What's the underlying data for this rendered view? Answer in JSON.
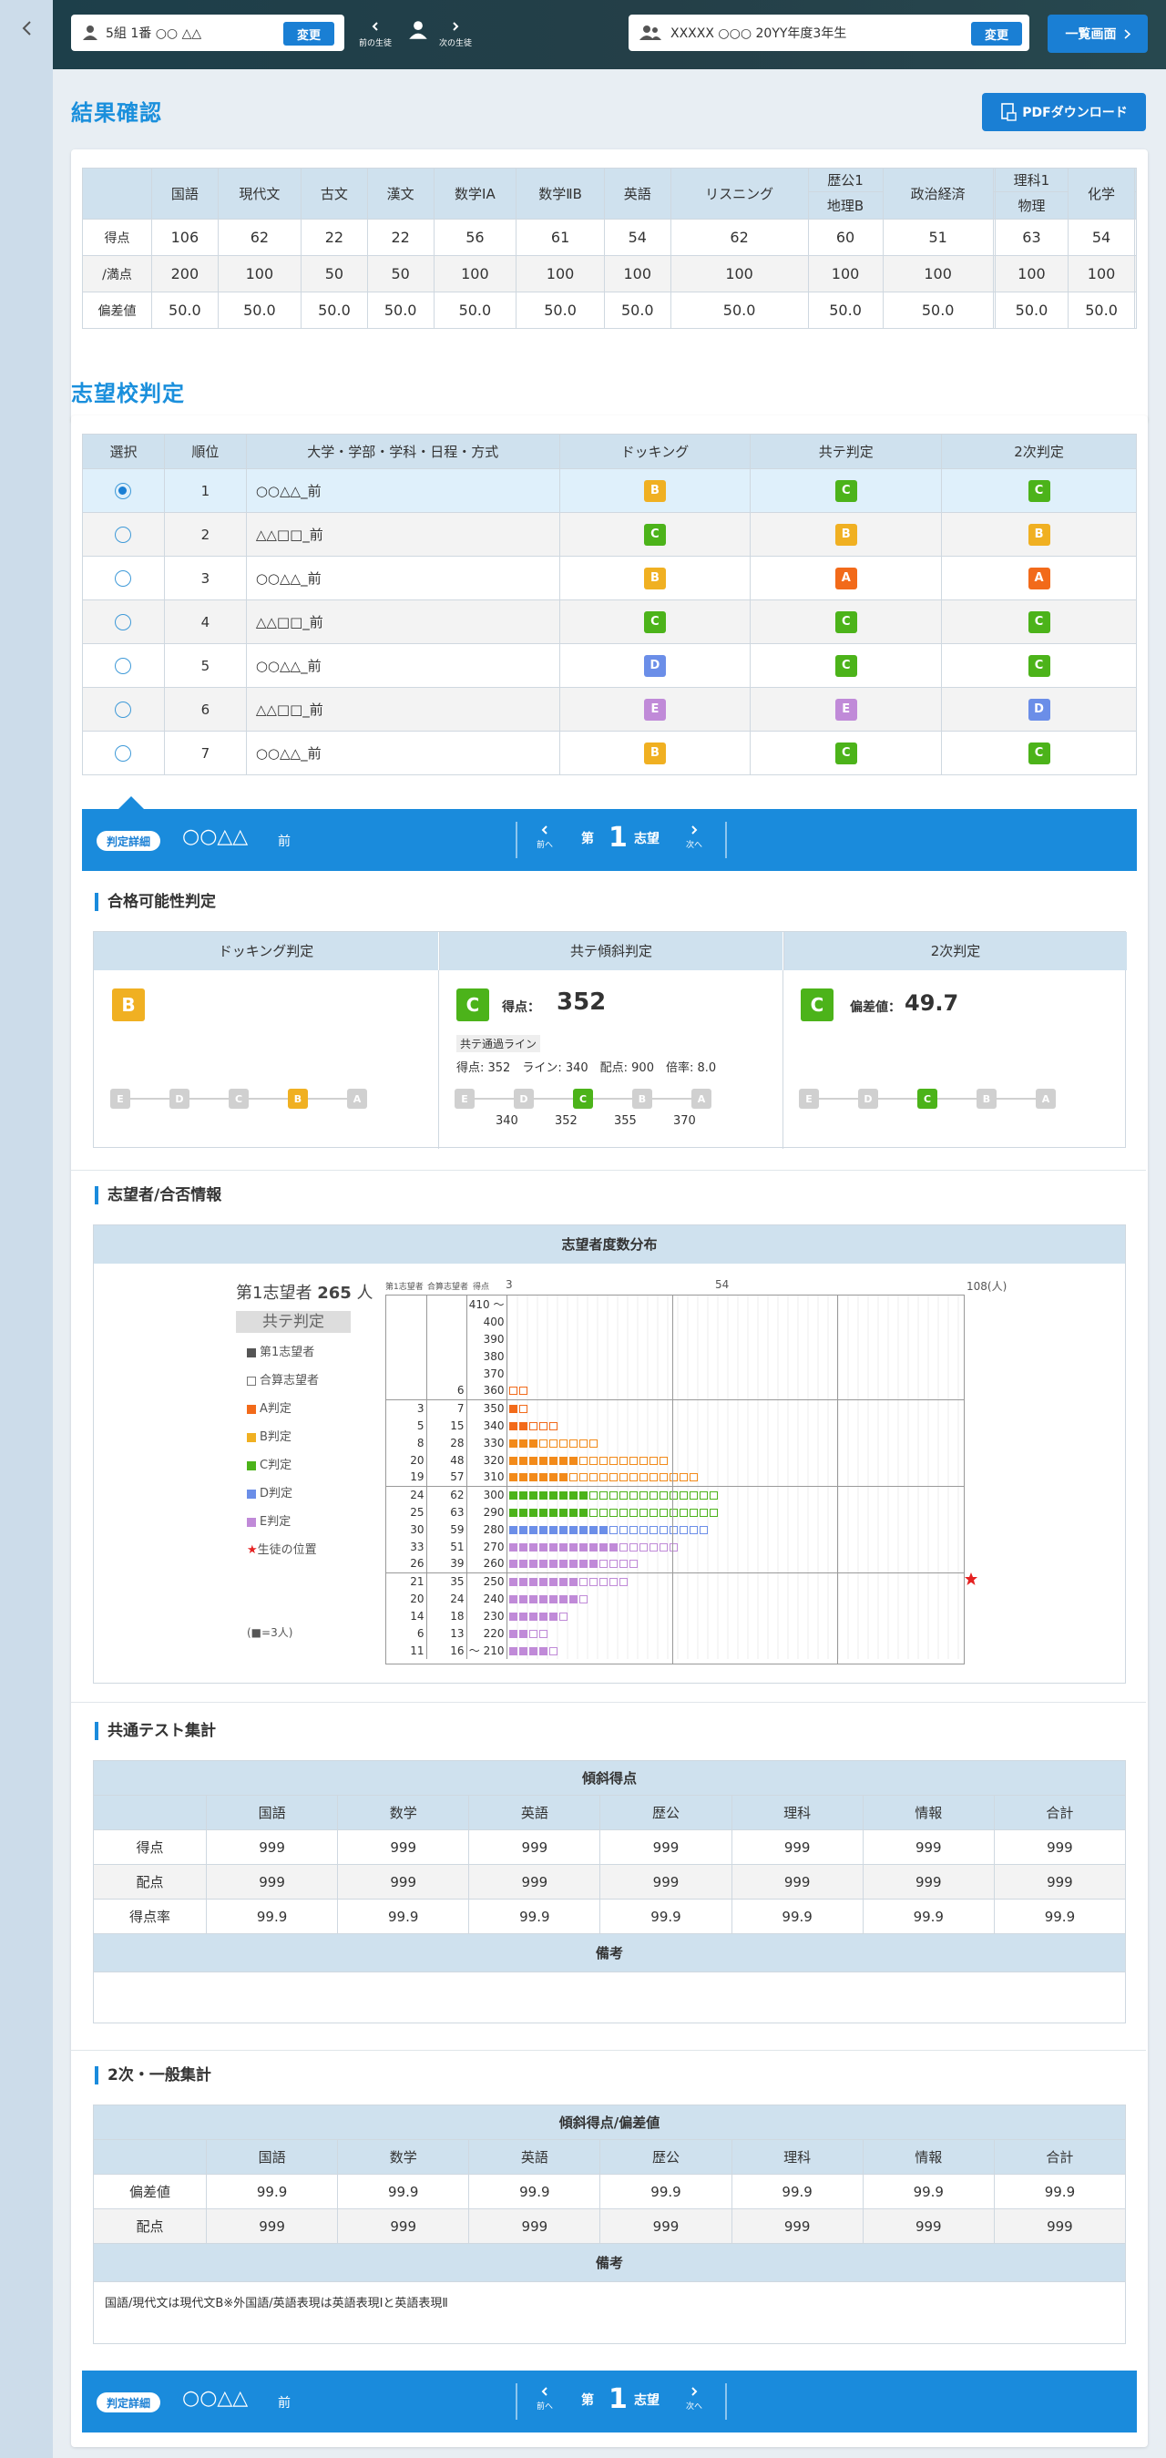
{
  "topbar": {
    "student": "5組 1番 ○○ △△",
    "change": "変更",
    "prev": "前の生徒",
    "next": "次の生徒",
    "exam": "XXXXX ○○○ 20YY年度3年生",
    "change2": "変更",
    "list": "一覧画面"
  },
  "result": {
    "title": "結果確認",
    "pdf": "PDFダウンロード",
    "headers": [
      "国語",
      "現代文",
      "古文",
      "漢文",
      "数学ⅠA",
      "数学ⅡB",
      "英語",
      "リスニング",
      "地理B",
      "政治経済",
      "",
      "物理",
      "化学",
      ""
    ],
    "group_top": [
      "",
      "",
      "",
      "",
      "",
      "",
      "",
      "",
      "歴公1",
      "",
      "",
      "理科1",
      "",
      ""
    ],
    "rows": [
      {
        "label": "得点",
        "values": [
          "106",
          "62",
          "22",
          "22",
          "56",
          "61",
          "54",
          "62",
          "60",
          "51",
          "",
          "63",
          "54",
          ""
        ]
      },
      {
        "label": "/満点",
        "values": [
          "200",
          "100",
          "50",
          "50",
          "100",
          "100",
          "100",
          "100",
          "100",
          "100",
          "",
          "100",
          "100",
          ""
        ]
      },
      {
        "label": "偏差値",
        "values": [
          "50.0",
          "50.0",
          "50.0",
          "50.0",
          "50.0",
          "50.0",
          "50.0",
          "50.0",
          "50.0",
          "50.0",
          "",
          "50.0",
          "50.0",
          ""
        ]
      }
    ]
  },
  "judge": {
    "title": "志望校判定",
    "headers": [
      "選択",
      "順位",
      "大学・学部・学科・日程・方式",
      "ドッキング",
      "共テ判定",
      "2次判定"
    ],
    "rows": [
      {
        "rank": "1",
        "name": "○○△△_前",
        "dock": "B",
        "kyote": "C",
        "niji": "C",
        "selected": true
      },
      {
        "rank": "2",
        "name": "△△□□_前",
        "dock": "C",
        "kyote": "B",
        "niji": "B",
        "selected": false
      },
      {
        "rank": "3",
        "name": "○○△△_前",
        "dock": "B",
        "kyote": "A",
        "niji": "A",
        "selected": false
      },
      {
        "rank": "4",
        "name": "△△□□_前",
        "dock": "C",
        "kyote": "C",
        "niji": "C",
        "selected": false
      },
      {
        "rank": "5",
        "name": "○○△△_前",
        "dock": "D",
        "kyote": "C",
        "niji": "C",
        "selected": false
      },
      {
        "rank": "6",
        "name": "△△□□_前",
        "dock": "E",
        "kyote": "E",
        "niji": "D",
        "selected": false
      },
      {
        "rank": "7",
        "name": "○○△△_前",
        "dock": "B",
        "kyote": "C",
        "niji": "C",
        "selected": false
      }
    ]
  },
  "detail": {
    "pill": "判定詳細",
    "school": "○○△△",
    "sched": "前",
    "prev": "前へ",
    "next": "次へ",
    "dai": "第",
    "num": "1",
    "shibo": "志望"
  },
  "possibility": {
    "title": "合格可能性判定",
    "col1": "ドッキング判定",
    "col2": "共テ傾斜判定",
    "col3": "2次判定",
    "dock_grade": "B",
    "kyote_grade": "C",
    "score_label": "得点：",
    "score": "352",
    "niji_grade": "C",
    "dev_label": "偏差値：",
    "dev": "49.7",
    "line_label": "共テ通過ライン",
    "line_detail": "得点: 352　ライン: 340　配点: 900　倍率: 8.0",
    "scale": [
      "E",
      "D",
      "C",
      "B",
      "A"
    ],
    "kyote_nums": [
      "340",
      "352",
      "355",
      "370"
    ]
  },
  "applicants": {
    "title": "志望者/合否情報",
    "table_title": "志望者度数分布",
    "count_label": "第1志望者",
    "count": "265",
    "count_unit": "人",
    "kyote": "共テ判定",
    "legend": [
      "第1志望者",
      "合算志望者",
      "A判定",
      "B判定",
      "C判定",
      "D判定",
      "E判定",
      "生徒の位置"
    ],
    "unit_note": "(■=3人)",
    "col_heads": [
      "第1志望者",
      "合算志望者",
      "得点"
    ],
    "axis": [
      "3",
      "54",
      "108(人)"
    ],
    "rows": [
      {
        "a": "",
        "b": "",
        "s": "410 ～"
      },
      {
        "a": "",
        "b": "",
        "s": "400"
      },
      {
        "a": "",
        "b": "",
        "s": "390"
      },
      {
        "a": "",
        "b": "",
        "s": "380"
      },
      {
        "a": "",
        "b": "",
        "s": "370"
      },
      {
        "a": "",
        "b": "6",
        "s": "360"
      },
      {
        "a": "3",
        "b": "7",
        "s": "350"
      },
      {
        "a": "5",
        "b": "15",
        "s": "340"
      },
      {
        "a": "8",
        "b": "28",
        "s": "330"
      },
      {
        "a": "20",
        "b": "48",
        "s": "320"
      },
      {
        "a": "19",
        "b": "57",
        "s": "310"
      },
      {
        "a": "24",
        "b": "62",
        "s": "300"
      },
      {
        "a": "25",
        "b": "63",
        "s": "290"
      },
      {
        "a": "30",
        "b": "59",
        "s": "280"
      },
      {
        "a": "33",
        "b": "51",
        "s": "270"
      },
      {
        "a": "26",
        "b": "39",
        "s": "260"
      },
      {
        "a": "21",
        "b": "35",
        "s": "250"
      },
      {
        "a": "20",
        "b": "24",
        "s": "240"
      },
      {
        "a": "14",
        "b": "18",
        "s": "230"
      },
      {
        "a": "6",
        "b": "13",
        "s": "220"
      },
      {
        "a": "11",
        "b": "16",
        "s": "～ 210"
      }
    ]
  },
  "common": {
    "title": "共通テスト集計",
    "head": "傾斜得点",
    "cols": [
      "国語",
      "数学",
      "英語",
      "歴公",
      "理科",
      "情報",
      "合計"
    ],
    "rows": [
      {
        "label": "得点",
        "values": [
          "999",
          "999",
          "999",
          "999",
          "999",
          "999",
          "999"
        ]
      },
      {
        "label": "配点",
        "values": [
          "999",
          "999",
          "999",
          "999",
          "999",
          "999",
          "999"
        ]
      },
      {
        "label": "得点率",
        "values": [
          "99.9",
          "99.9",
          "99.9",
          "99.9",
          "99.9",
          "99.9",
          "99.9"
        ]
      }
    ],
    "note_head": "備考",
    "note": ""
  },
  "second": {
    "title": "2次・一般集計",
    "head": "傾斜得点/偏差値",
    "cols": [
      "国語",
      "数学",
      "英語",
      "歴公",
      "理科",
      "情報",
      "合計"
    ],
    "rows": [
      {
        "label": "偏差値",
        "values": [
          "99.9",
          "99.9",
          "99.9",
          "99.9",
          "99.9",
          "99.9",
          "99.9"
        ]
      },
      {
        "label": "配点",
        "values": [
          "999",
          "999",
          "999",
          "999",
          "999",
          "999",
          "999"
        ]
      }
    ],
    "note_head": "備考",
    "note": "国語/現代文は現代文B※外国語/英語表現は英語表現Ⅰと英語表現Ⅱ"
  }
}
